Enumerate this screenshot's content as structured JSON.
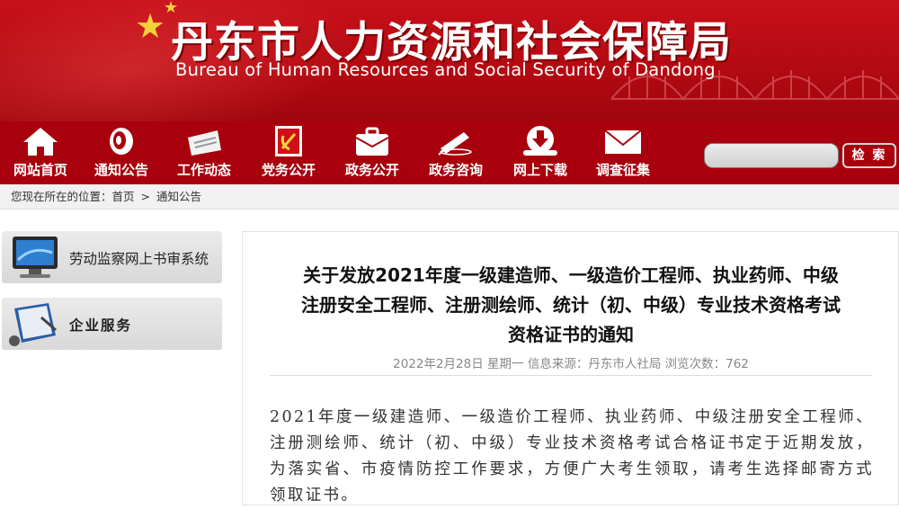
{
  "banner": {
    "title_cn": "丹东市人力资源和社会保障局",
    "title_en": "Bureau of Human Resources and Social Security of Dandong",
    "colors": {
      "banner_red": "#c8101a",
      "nav_red": "#a8000c",
      "star_gold": "#f3d23a"
    }
  },
  "nav": {
    "items": [
      {
        "label": "网站首页",
        "icon": "home-icon"
      },
      {
        "label": "通知公告",
        "icon": "megaphone-icon"
      },
      {
        "label": "工作动态",
        "icon": "newspaper-icon"
      },
      {
        "label": "党务公开",
        "icon": "party-emblem-icon"
      },
      {
        "label": "政务公开",
        "icon": "briefcase-icon"
      },
      {
        "label": "政务咨询",
        "icon": "pen-icon"
      },
      {
        "label": "网上下载",
        "icon": "download-icon"
      },
      {
        "label": "调查征集",
        "icon": "envelope-icon"
      }
    ],
    "search_button": "检 索"
  },
  "breadcrumb": {
    "prefix": "您现在所在的位置：",
    "items": [
      "首页",
      "通知公告"
    ],
    "separator": ">"
  },
  "sidebar": {
    "items": [
      {
        "label": "劳动监察网上书审系统",
        "icon": "monitor-icon"
      },
      {
        "label": "企业服务",
        "icon": "notebook-icon"
      }
    ]
  },
  "article": {
    "title_lines": [
      "关于发放2021年度一级建造师、一级造价工程师、执业药师、中级",
      "注册安全工程师、注册测绘师、统计（初、中级）专业技术资格考试",
      "资格证书的通知"
    ],
    "meta": "2022年2月28日 星期一 信息来源：丹东市人社局 浏览次数：762",
    "body": "2021年度一级建造师、一级造价工程师、执业药师、中级注册安全工程师、注册测绘师、统计（初、中级）专业技术资格考试合格证书定于近期发放，为落实省、市疫情防控工作要求，方便广大考生领取，请考生选择邮寄方式领取证书。"
  }
}
